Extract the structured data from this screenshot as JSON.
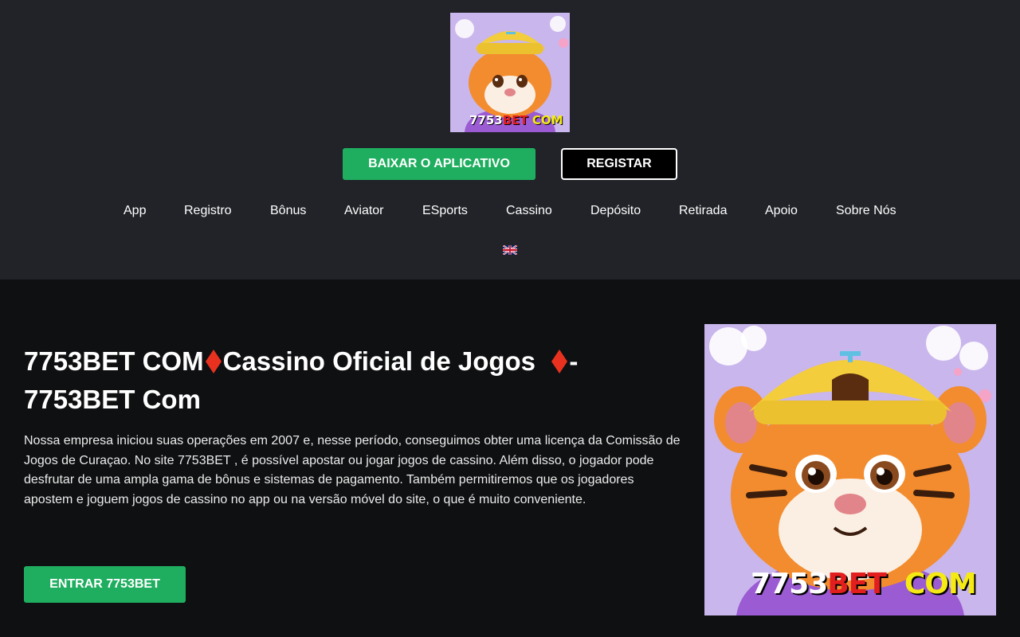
{
  "header": {
    "logo": {
      "icon": "tiger-mascot",
      "brand_number": "7753",
      "brand_bet": "BET",
      "brand_com": "COM"
    },
    "download_label": "BAIXAR O APLICATIVO",
    "register_label": "REGISTAR",
    "language_icon": "uk-flag-icon"
  },
  "nav": {
    "items": [
      "App",
      "Registro",
      "Bônus",
      "Aviator",
      "ESports",
      "Cassino",
      "Depósito",
      "Retirada",
      "Apoio",
      "Sobre Nós"
    ]
  },
  "main": {
    "title_part1": "7753BET COM",
    "title_part2": "Cassino Oficial de Jogos",
    "title_part3": "-",
    "title_part4": "7753BET Com",
    "description": "Nossa empresa iniciou suas operações em 2007 e, nesse período, conseguimos obter uma licença da Comissão de Jogos de Curaçao. No site 7753BET , é possível apostar ou jogar jogos de cassino. Além disso, o jogador pode desfrutar de uma ampla gama de bônus e sistemas de pagamento. Também permitiremos que os jogadores apostem e joguem jogos de cassino no app ou na versão móvel do site, o que é muito conveniente.",
    "enter_label": "ENTRAR 7753BET",
    "hero_image": {
      "icon": "tiger-mascot",
      "brand_number": "7753",
      "brand_bet": "BET",
      "brand_com": "COM"
    }
  },
  "colors": {
    "header_bg": "#212328",
    "page_bg": "#0f1012",
    "accent_green": "#1fae5f",
    "diamond_red": "#e8321f",
    "brand_red": "#e21e1e",
    "brand_yellow": "#f5ea14"
  }
}
